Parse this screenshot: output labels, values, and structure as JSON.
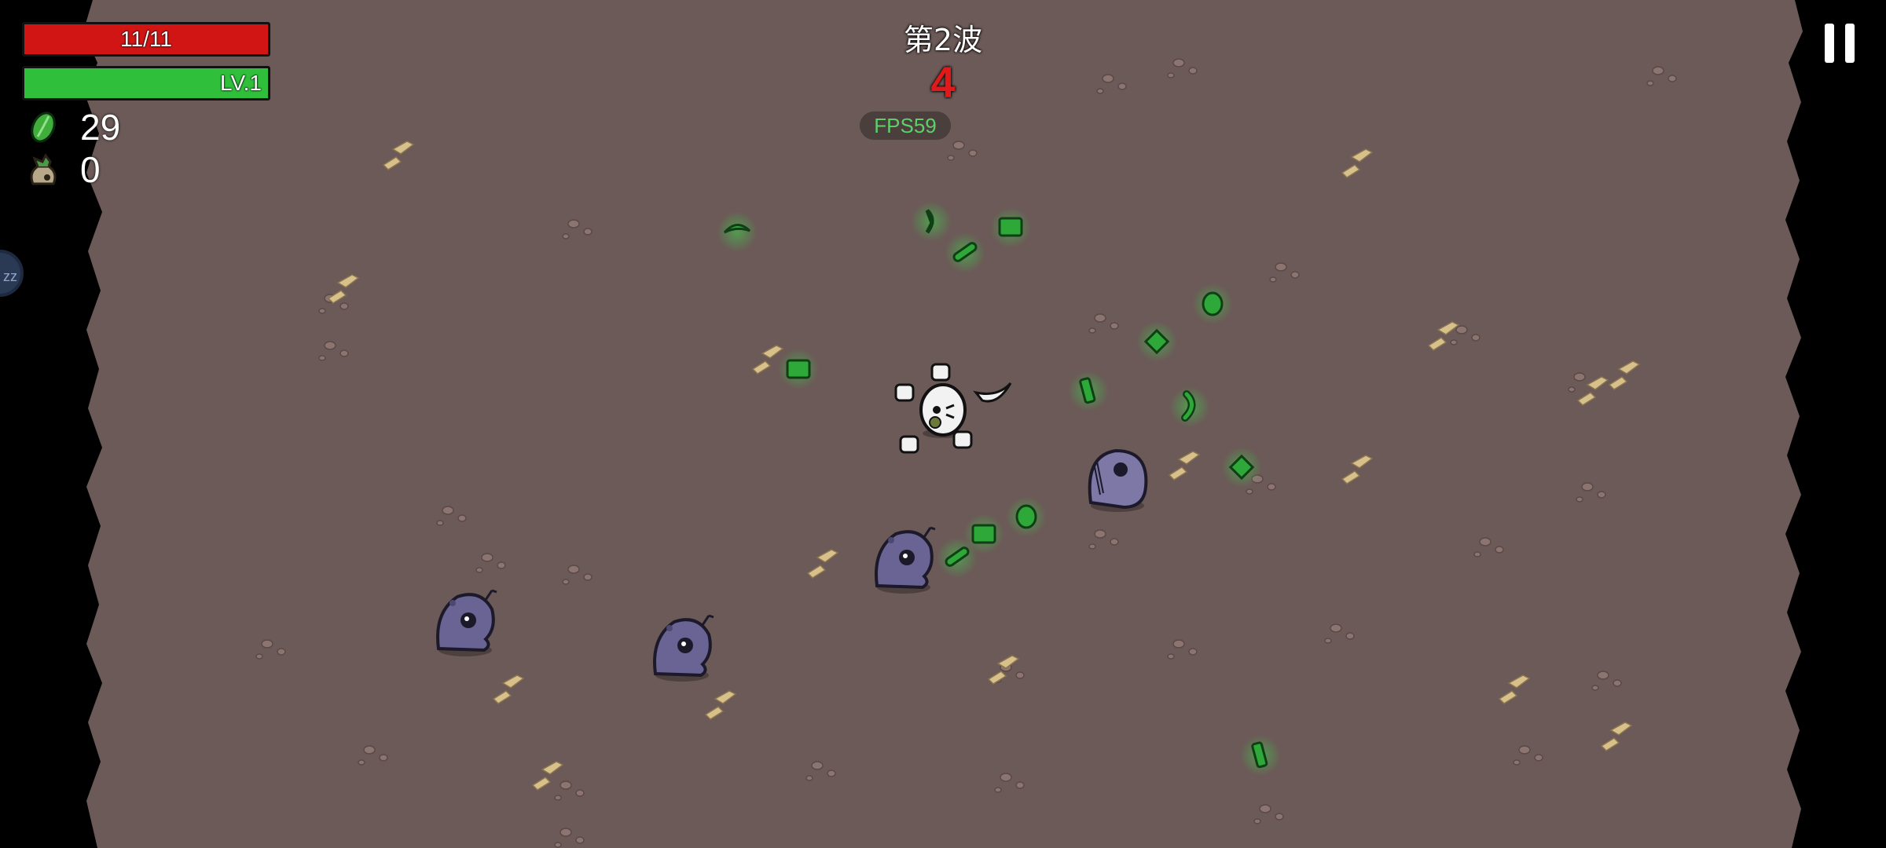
{
  "hud": {
    "health": {
      "current": 11,
      "max": 11,
      "label": "11/11"
    },
    "level": {
      "label": "LV.1",
      "progress": 1.0
    },
    "materials": {
      "icon": "green-leaf-icon",
      "count": "29"
    },
    "bag": {
      "icon": "money-bag-icon",
      "count": "0"
    }
  },
  "wave": {
    "title": "第2波",
    "timer": "4"
  },
  "fps": "FPS59",
  "controls": {
    "pause_icon": "pause-icon",
    "sleep_label": "zz"
  },
  "colors": {
    "ground": "#6b5a57",
    "health": "#d11515",
    "xp": "#2fbf3a",
    "material_glow": "#3ed14a",
    "enemy": "#6a6494",
    "timer": "#e01a1a"
  }
}
